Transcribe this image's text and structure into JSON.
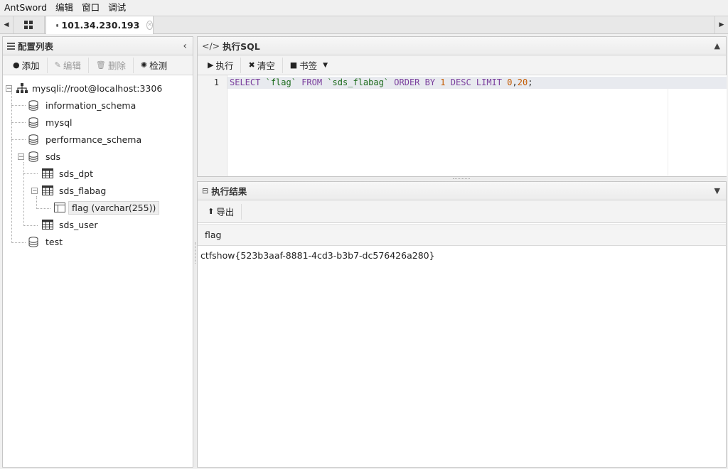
{
  "menubar": {
    "items": [
      "AntSword",
      "编辑",
      "窗口",
      "调试"
    ]
  },
  "tabs": {
    "active_label": "101.34.230.193"
  },
  "config_panel": {
    "title": "配置列表",
    "toolbar": {
      "add": "添加",
      "edit": "编辑",
      "delete": "删除",
      "detect": "检测"
    }
  },
  "tree": {
    "root": "mysqli://root@localhost:3306",
    "databases": [
      "information_schema",
      "mysql",
      "performance_schema",
      "sds",
      "test"
    ],
    "sds_tables": [
      "sds_dpt",
      "sds_flabag",
      "sds_user"
    ],
    "flabag_column": "flag (varchar(255))"
  },
  "sql_panel": {
    "title": "执行SQL",
    "toolbar": {
      "execute": "执行",
      "clear": "清空",
      "bookmark": "书签"
    },
    "line_number": "1",
    "query_tokens": {
      "select": "SELECT",
      "field": "`flag`",
      "from": "FROM",
      "table": "`sds_flabag`",
      "order_by": "ORDER BY",
      "order_num": "1",
      "desc": "DESC",
      "limit": "LIMIT",
      "offset": "0",
      "comma": ",",
      "count": "20",
      "semicolon": ";"
    }
  },
  "result_panel": {
    "title": "执行结果",
    "toolbar": {
      "export": "导出"
    },
    "columns": [
      "flag"
    ],
    "rows": [
      [
        "ctfshow{523b3aaf-8881-4cd3-b3b7-dc576426a280}"
      ]
    ]
  }
}
